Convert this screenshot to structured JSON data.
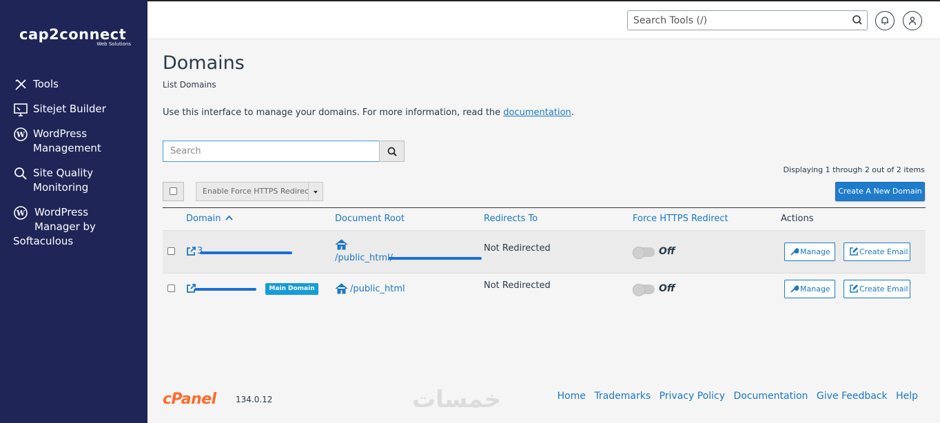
{
  "brand": {
    "logo_text": "cap2connect",
    "logo_sub": "Web Solutions"
  },
  "sidebar": {
    "items": [
      {
        "label": "Tools"
      },
      {
        "label": "Sitejet Builder"
      },
      {
        "label_line1": "WordPress",
        "label_line2": "Management"
      },
      {
        "label_line1": "Site Quality",
        "label_line2": "Monitoring"
      },
      {
        "label_line1": "WordPress",
        "label_line2": "Manager by",
        "label_line3": "Softaculous"
      }
    ]
  },
  "header": {
    "search_placeholder": "Search Tools (/)"
  },
  "page": {
    "title": "Domains",
    "subtitle": "List Domains",
    "intro_text": "Use this interface to manage your domains. For more information, read the ",
    "intro_link": "documentation",
    "intro_end": "."
  },
  "controls": {
    "search_placeholder": "Search",
    "displaying": "Displaying 1 through 2 out of 2 items",
    "force_https_label": "Enable Force HTTPS Redirect",
    "create_label": "Create A New Domain"
  },
  "table": {
    "headers": {
      "domain": "Domain",
      "docroot": "Document Root",
      "redirects": "Redirects To",
      "force_https": "Force HTTPS Redirect",
      "actions": "Actions"
    },
    "rows": [
      {
        "domain_prefix": "3",
        "docroot": "/public_html/",
        "redirects": "Not Redirected",
        "force_https": "Off",
        "manage": "Manage",
        "create_email": "Create Email"
      },
      {
        "badge": "Main Domain",
        "docroot": "/public_html",
        "redirects": "Not Redirected",
        "force_https": "Off",
        "manage": "Manage",
        "create_email": "Create Email"
      }
    ]
  },
  "footer": {
    "cpanel": "cPanel",
    "version": "134.0.12",
    "watermark": "خمسات",
    "links": [
      "Home",
      "Trademarks",
      "Privacy Policy",
      "Documentation",
      "Give Feedback",
      "Help"
    ]
  }
}
